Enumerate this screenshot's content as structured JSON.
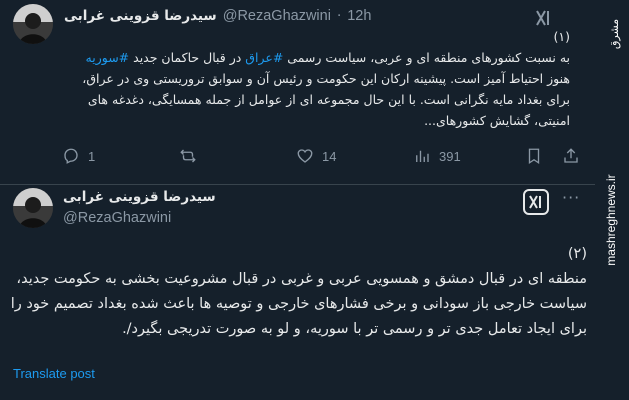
{
  "tweet1": {
    "author_name": "سیدرضا قزوینی غرابی",
    "handle": "@RezaGhazwini",
    "separator": "·",
    "time": "12h",
    "number_marker": "(۱)",
    "body_part1": "به نسبت کشورهای منطقه ای و عربی، سیاست رسمی ",
    "hashtag1": "#عراق",
    "body_part2": " در قبال حاکمان جدید ",
    "hashtag2": "#سوریه",
    "body_part3": " هنوز احتیاط آمیز است. پیشینه ارکان این حکومت و رئیس آن و سوابق تروریستی وی در عراق، برای بغداد مایه نگرانی است. با این حال مجموعه ای از عوامل از جمله همسایگی، دغدغه های امنیتی، گشایش کشورهای...",
    "replies": "1",
    "retweets": "",
    "likes": "14",
    "views": "391"
  },
  "tweet2": {
    "author_name": "سیدرضا قزوینی غرابی",
    "handle": "@RezaGhazwini",
    "number_marker": "(۲)",
    "body": "منطقه ای در قبال دمشق و همسویی عربی و غربی در قبال مشروعیت بخشی به حکومت جدید، سیاست خارجی باز سودانی و برخی فشارهای خارجی و توصیه ها باعث شده بغداد تصمیم خود را برای ایجاد تعامل جدی تر و رسمی تر با سوریه، و لو به صورت تدریجی بگیرد/.",
    "translate_label": "Translate post",
    "more_label": "···"
  },
  "watermark": {
    "brand": "مشرق",
    "url": "mashreghnews.ir"
  },
  "colors": {
    "background": "#15202b",
    "accent": "#1d9bf0",
    "text": "#e7e9ea",
    "muted": "#8b98a5"
  }
}
